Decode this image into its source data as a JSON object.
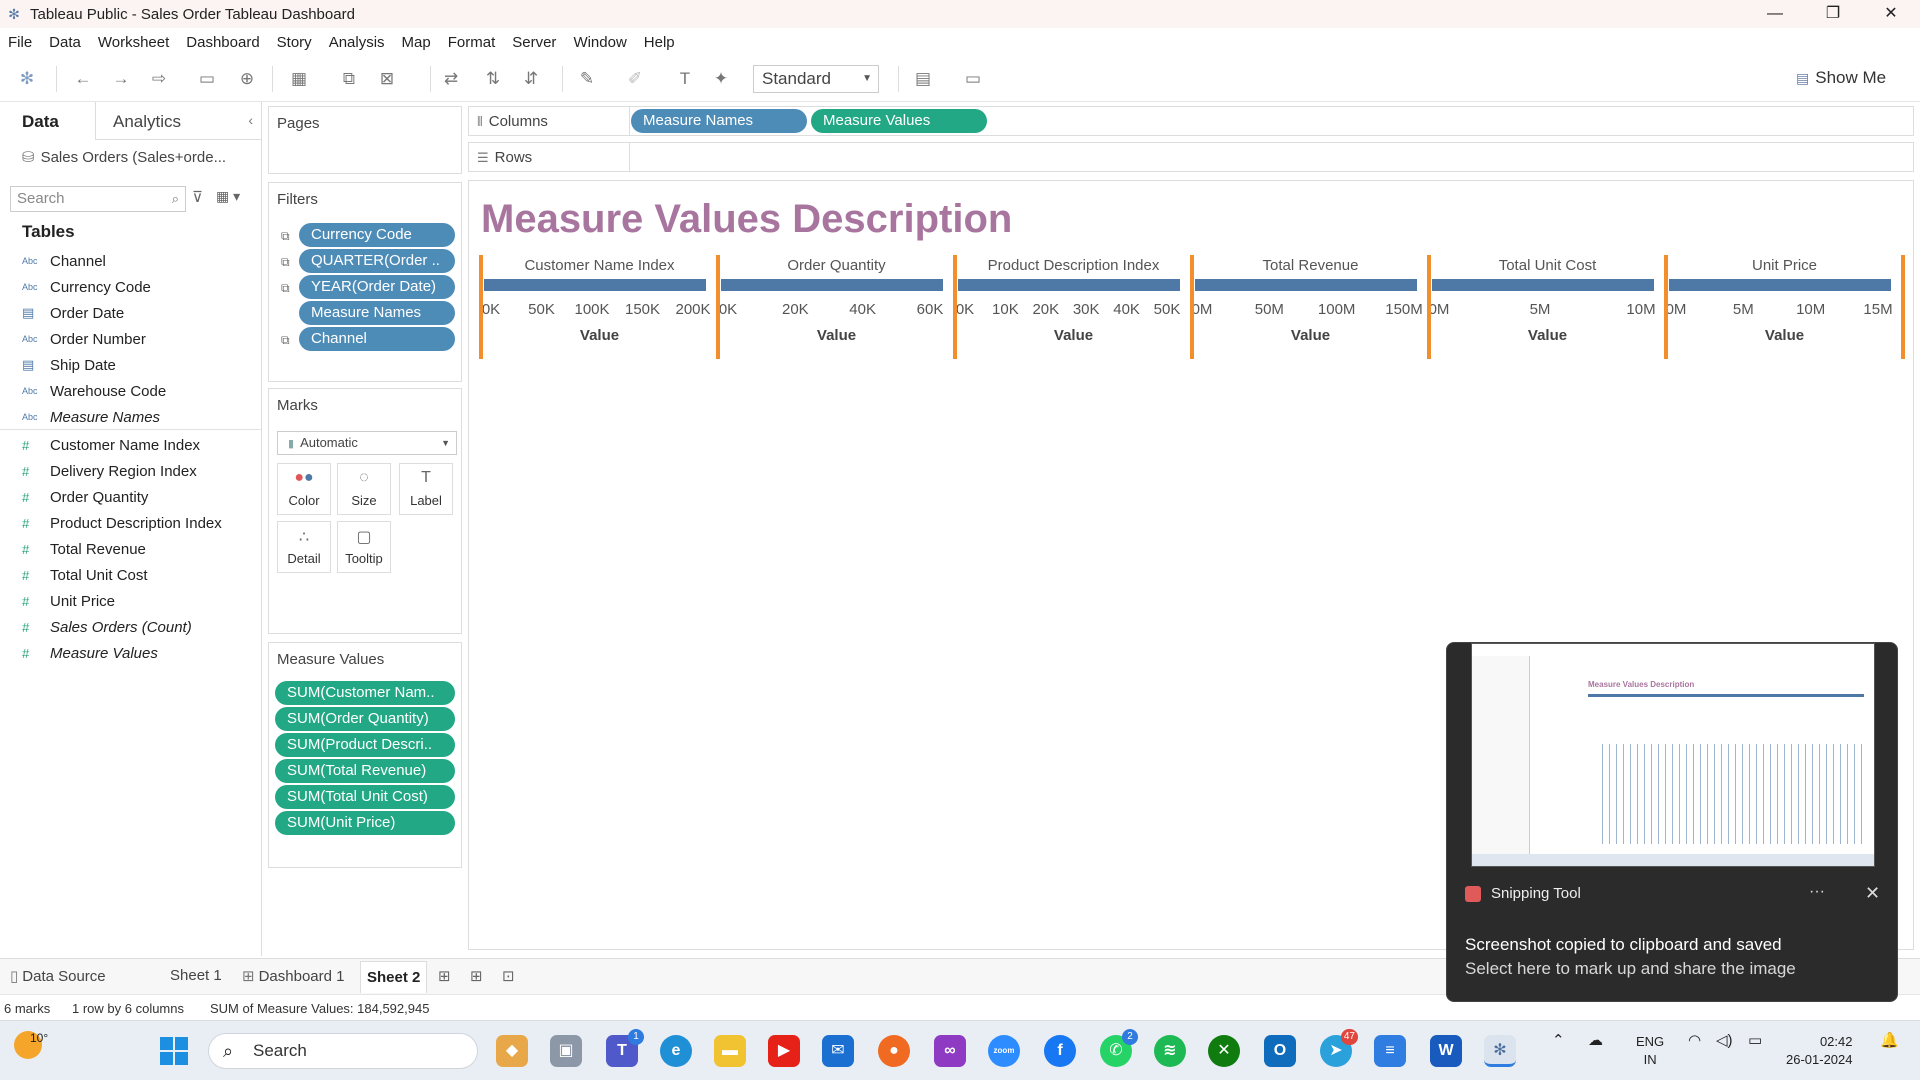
{
  "window": {
    "title": "Tableau Public - Sales Order Tableau Dashboard",
    "controls": [
      "—",
      "❐",
      "✕"
    ]
  },
  "menu": [
    "File",
    "Data",
    "Worksheet",
    "Dashboard",
    "Story",
    "Analysis",
    "Map",
    "Format",
    "Server",
    "Window",
    "Help"
  ],
  "toolbar": {
    "fit_select": "Standard",
    "show_me": "Show Me"
  },
  "data_pane": {
    "tabs": [
      "Data",
      "Analytics"
    ],
    "source": "Sales Orders (Sales+orde...",
    "search_placeholder": "Search",
    "tables_heading": "Tables",
    "dimensions": [
      {
        "label": "Channel",
        "icon": "Abc"
      },
      {
        "label": "Currency Code",
        "icon": "Abc"
      },
      {
        "label": "Order Date",
        "icon": "calendar-icon"
      },
      {
        "label": "Order Number",
        "icon": "Abc"
      },
      {
        "label": "Ship Date",
        "icon": "calendar-icon"
      },
      {
        "label": "Warehouse Code",
        "icon": "Abc"
      },
      {
        "label": "Measure Names",
        "icon": "Abc"
      }
    ],
    "measures": [
      {
        "label": "Customer Name Index"
      },
      {
        "label": "Delivery Region Index"
      },
      {
        "label": "Order Quantity"
      },
      {
        "label": "Product Description Index"
      },
      {
        "label": "Total Revenue"
      },
      {
        "label": "Total Unit Cost"
      },
      {
        "label": "Unit Price"
      },
      {
        "label": "Sales Orders (Count)"
      },
      {
        "label": "Measure Values"
      }
    ]
  },
  "pages": {
    "title": "Pages"
  },
  "filters": {
    "title": "Filters",
    "pills": [
      "Currency Code",
      "QUARTER(Order ..",
      "YEAR(Order Date)",
      "Measure Names",
      "Channel"
    ]
  },
  "marks": {
    "title": "Marks",
    "type": "Automatic",
    "buttons": [
      "Color",
      "Size",
      "Label",
      "Detail",
      "Tooltip"
    ]
  },
  "measure_values": {
    "title": "Measure Values",
    "pills": [
      "SUM(Customer Nam..",
      "SUM(Order Quantity)",
      "SUM(Product Descri..",
      "SUM(Total Revenue)",
      "SUM(Total Unit Cost)",
      "SUM(Unit Price)"
    ]
  },
  "columns_shelf": {
    "label": "Columns",
    "pills": [
      "Measure Names",
      "Measure Values"
    ]
  },
  "rows_shelf": {
    "label": "Rows"
  },
  "viz": {
    "title": "Measure Values Description",
    "axis_label": "Value"
  },
  "chart_data": {
    "type": "bar",
    "title": "Measure Values Description",
    "orientation": "horizontal",
    "xlabel": "Value",
    "panes": [
      {
        "name": "Customer Name Index",
        "ticks": [
          "0K",
          "50K",
          "100K",
          "150K",
          "200K"
        ],
        "xlim": [
          0,
          200000
        ],
        "value": 200000
      },
      {
        "name": "Order Quantity",
        "ticks": [
          "0K",
          "20K",
          "40K",
          "60K"
        ],
        "xlim": [
          0,
          67000
        ],
        "value": 67000
      },
      {
        "name": "Product Description Index",
        "ticks": [
          "0K",
          "10K",
          "20K",
          "30K",
          "40K",
          "50K"
        ],
        "xlim": [
          0,
          50000
        ],
        "value": 50000
      },
      {
        "name": "Total Revenue",
        "ticks": [
          "0M",
          "50M",
          "100M",
          "150M"
        ],
        "xlim": [
          0,
          150000000
        ],
        "value": 150000000
      },
      {
        "name": "Total Unit Cost",
        "ticks": [
          "0M",
          "5M",
          "10M"
        ],
        "xlim": [
          0,
          11000000
        ],
        "value": 11000000
      },
      {
        "name": "Unit Price",
        "ticks": [
          "0M",
          "5M",
          "10M",
          "15M"
        ],
        "xlim": [
          0,
          18000000
        ],
        "value": 18000000
      }
    ]
  },
  "sheet_tabs": [
    "Data Source",
    "Sheet 1",
    "Dashboard 1",
    "Sheet 2"
  ],
  "status": {
    "marks": "6 marks",
    "layout": "1 row by 6 columns",
    "sum": "SUM of Measure Values: 184,592,945"
  },
  "taskbar": {
    "temperature": "10°",
    "search": "Search",
    "teams_badge": "1",
    "whatsapp_badge": "2",
    "telegram_badge": "47",
    "language": "ENG",
    "region": "IN",
    "time": "02:42",
    "date": "26-01-2024"
  },
  "toast": {
    "app": "Snipping Tool",
    "more": "···",
    "title": "Screenshot copied to clipboard and saved",
    "subtitle": "Select here to mark up and share the image",
    "thumb_title": "Measure Values Description"
  }
}
